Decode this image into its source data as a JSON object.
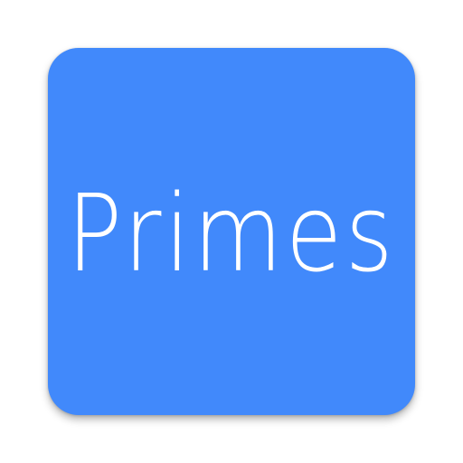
{
  "app_icon": {
    "label": "Primes",
    "background_color": "#4189fb",
    "text_color": "#ffffff"
  }
}
